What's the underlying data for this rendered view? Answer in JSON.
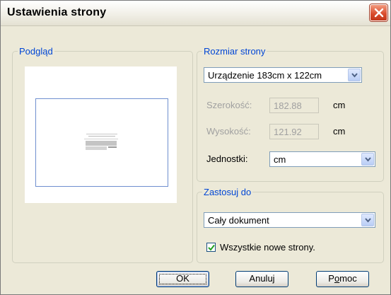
{
  "window": {
    "title": "Ustawienia strony"
  },
  "preview": {
    "legend": "Podgląd"
  },
  "page_size": {
    "legend": "Rozmiar strony",
    "device_value": "Urządzenie 183cm x 122cm",
    "width_label": "Szerokość:",
    "width_value": "182.88",
    "width_unit": "cm",
    "height_label": "Wysokość:",
    "height_value": "121.92",
    "height_unit": "cm",
    "units_label": "Jednostki:",
    "units_value": "cm"
  },
  "apply_to": {
    "legend": "Zastosuj do",
    "scope_value": "Cały dokument",
    "checkbox_label": "Wszystkie nowe strony.",
    "checkbox_checked": true
  },
  "buttons": {
    "ok": "OK",
    "cancel": "Anuluj",
    "help_prefix": "P",
    "help_underlined": "o",
    "help_suffix": "moc"
  },
  "icons": {
    "close": "close-icon",
    "dropdown": "chevron-down-icon",
    "check": "check-icon"
  },
  "colors": {
    "legend_text": "#0046d5",
    "close_button": "#d84a2a",
    "dialog_bg": "#ece9d8"
  }
}
